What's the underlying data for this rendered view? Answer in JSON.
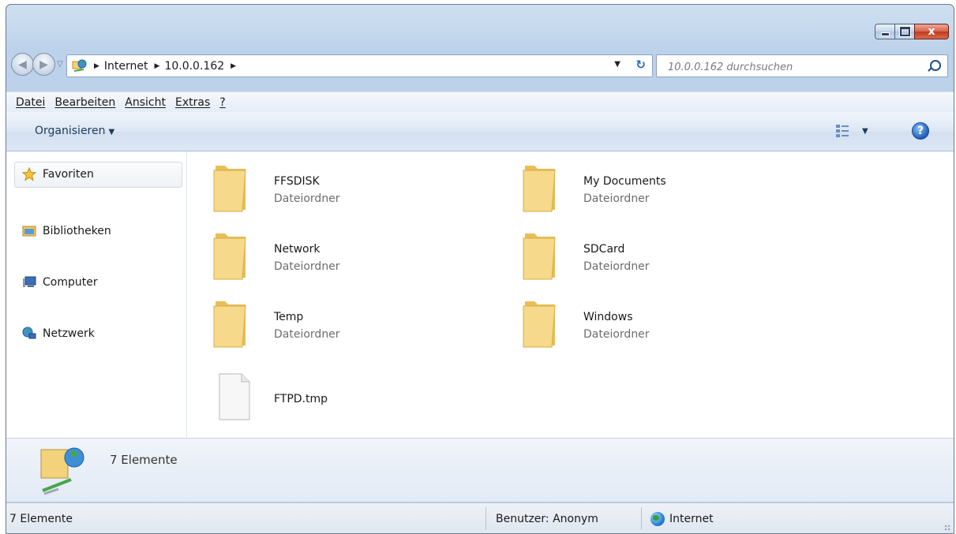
{
  "window": {
    "minimize_label": "",
    "maximize_label": "",
    "close_label": "x"
  },
  "nav": {
    "back_label": "◀",
    "forward_label": "▶"
  },
  "address": {
    "segments": [
      "Internet",
      "10.0.0.162"
    ],
    "refresh_label": "⁴↑"
  },
  "search": {
    "placeholder": "10.0.0.162 durchsuchen"
  },
  "menu": {
    "items": [
      "Datei",
      "Bearbeiten",
      "Ansicht",
      "Extras",
      "?"
    ]
  },
  "command": {
    "organize_label": "Organisieren",
    "help_label": "?"
  },
  "sidebar": {
    "items": [
      "Favoriten",
      "Bibliotheken",
      "Computer",
      "Netzwerk"
    ]
  },
  "files": [
    {
      "name": "FFSDISK",
      "type": "Dateiordner"
    },
    {
      "name": "My Documents",
      "type": "Dateiordner"
    },
    {
      "name": "Network",
      "type": "Dateiordner"
    },
    {
      "name": "SDCard",
      "type": "Dateiordner"
    },
    {
      "name": "Temp",
      "type": "Dateiordner"
    },
    {
      "name": "Windows",
      "type": "Dateiordner"
    },
    {
      "name": "FTPD.tmp",
      "type": ""
    }
  ],
  "details": {
    "count": "7 Elemente"
  },
  "status": {
    "count": "7 Elemente",
    "user": "Benutzer: Anonym",
    "zone": "Internet"
  },
  "colors": {
    "folder": "#f2d27a",
    "accent": "#1e395b"
  }
}
